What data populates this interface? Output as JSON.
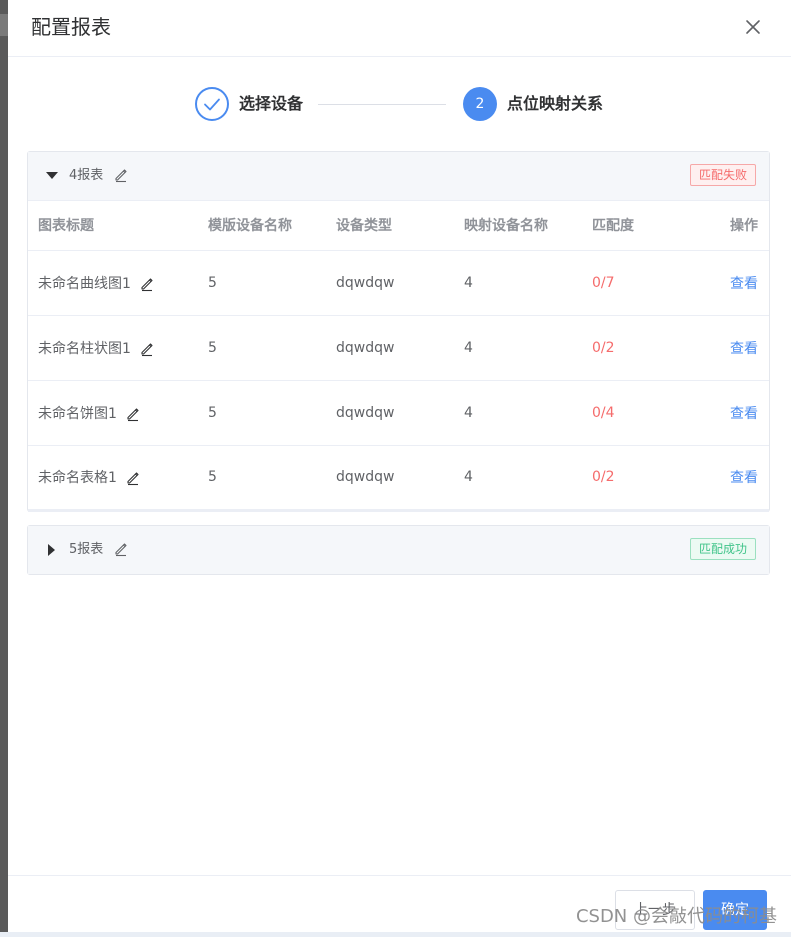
{
  "dialog": {
    "title": "配置报表",
    "close_icon": "close-icon"
  },
  "steps": [
    {
      "label": "选择设备",
      "state": "done"
    },
    {
      "label": "点位映射关系",
      "number": "2",
      "state": "active"
    }
  ],
  "panels": [
    {
      "name": "4报表",
      "expanded": true,
      "tag": "匹配失败",
      "columns": [
        "图表标题",
        "模版设备名称",
        "设备类型",
        "映射设备名称",
        "匹配度",
        "操作"
      ],
      "rows": [
        {
          "title": "未命名曲线图1",
          "template_device": "5",
          "device_type": "dqwdqw",
          "mapped_device": "4",
          "match": "0/7",
          "action": "查看"
        },
        {
          "title": "未命名柱状图1",
          "template_device": "5",
          "device_type": "dqwdqw",
          "mapped_device": "4",
          "match": "0/2",
          "action": "查看"
        },
        {
          "title": "未命名饼图1",
          "template_device": "5",
          "device_type": "dqwdqw",
          "mapped_device": "4",
          "match": "0/4",
          "action": "查看"
        },
        {
          "title": "未命名表格1",
          "template_device": "5",
          "device_type": "dqwdqw",
          "mapped_device": "4",
          "match": "0/2",
          "action": "查看"
        }
      ]
    },
    {
      "name": "5报表",
      "expanded": false,
      "tag": "匹配成功"
    }
  ],
  "footer": {
    "prev_label": "上一步",
    "ok_label": "确定"
  },
  "watermark": "CSDN @会敲代码的柯基",
  "colors": {
    "primary": "#4a8bf0",
    "danger": "#f56c6c",
    "success": "#41c48a"
  }
}
